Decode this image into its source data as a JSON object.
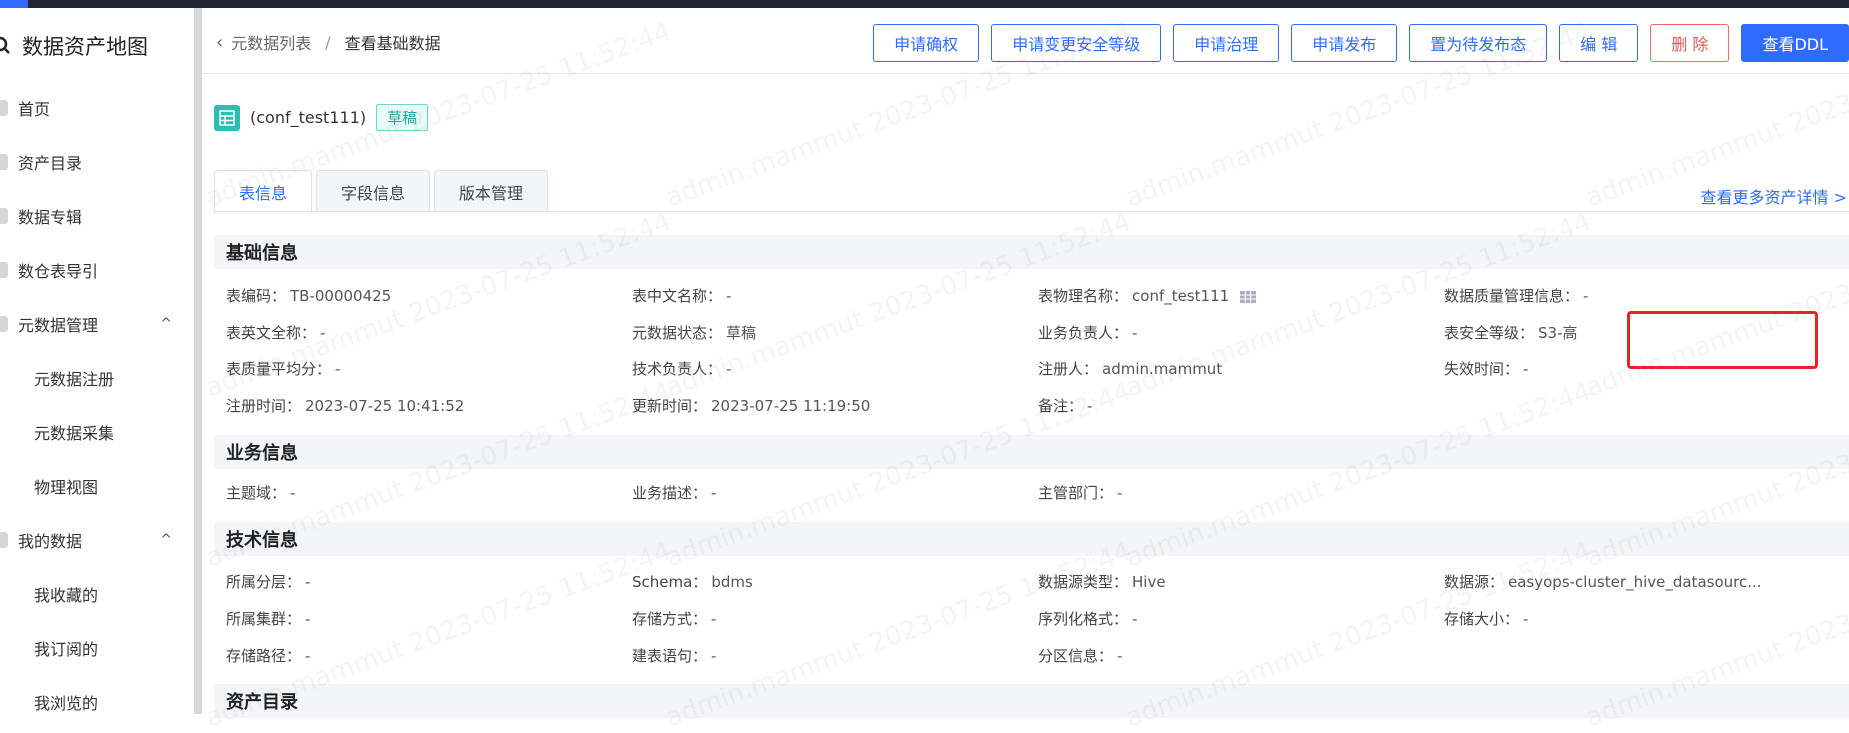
{
  "sidebar": {
    "title": "数据资产地图",
    "items": [
      {
        "label": "首页"
      },
      {
        "label": "资产目录"
      },
      {
        "label": "数据专辑"
      },
      {
        "label": "数仓表导引"
      },
      {
        "label": "元数据管理",
        "chevron": "^"
      },
      {
        "label": "元数据注册"
      },
      {
        "label": "元数据采集"
      },
      {
        "label": "物理视图"
      },
      {
        "label": "我的数据",
        "chevron": "^"
      },
      {
        "label": "我收藏的"
      },
      {
        "label": "我订阅的"
      },
      {
        "label": "我浏览的"
      }
    ]
  },
  "breadcrumb": {
    "parent": "元数据列表",
    "separator": "/",
    "current": "查看基础数据"
  },
  "actions": {
    "confirm_ownership": "申请确权",
    "change_security": "申请变更安全等级",
    "governance": "申请治理",
    "publish": "申请发布",
    "set_pending": "置为待发布态",
    "edit": "编 辑",
    "delete": "删 除",
    "view_ddl": "查看DDL"
  },
  "table": {
    "name": "(conf_test111)",
    "status_badge": "草稿"
  },
  "tabs": [
    {
      "label": "表信息"
    },
    {
      "label": "字段信息"
    },
    {
      "label": "版本管理"
    }
  ],
  "more_link": "查看更多资产详情 >",
  "sections": {
    "basic": {
      "title": "基础信息",
      "fields": {
        "code": {
          "k": "表编码：",
          "v": "TB-00000425"
        },
        "cn_name": {
          "k": "表中文名称：",
          "v": "-"
        },
        "physical_name": {
          "k": "表物理名称：",
          "v": "conf_test111"
        },
        "quality_info": {
          "k": "数据质量管理信息：",
          "v": "-"
        },
        "en_full_name": {
          "k": "表英文全称：",
          "v": "-"
        },
        "meta_status": {
          "k": "元数据状态：",
          "v": "草稿"
        },
        "biz_owner": {
          "k": "业务负责人：",
          "v": "-"
        },
        "security_level": {
          "k": "表安全等级：",
          "v": "S3-高"
        },
        "quality_avg": {
          "k": "表质量平均分：",
          "v": "-"
        },
        "tech_owner": {
          "k": "技术负责人：",
          "v": "-"
        },
        "registrant": {
          "k": "注册人：",
          "v": "admin.mammut"
        },
        "expire_time": {
          "k": "失效时间：",
          "v": "-"
        },
        "register_time": {
          "k": "注册时间：",
          "v": "2023-07-25 10:41:52"
        },
        "update_time": {
          "k": "更新时间：",
          "v": "2023-07-25 11:19:50"
        },
        "remark": {
          "k": "备注：",
          "v": "-"
        }
      }
    },
    "business": {
      "title": "业务信息",
      "fields": {
        "domain": {
          "k": "主题域：",
          "v": "-"
        },
        "desc": {
          "k": "业务描述：",
          "v": "-"
        },
        "dept": {
          "k": "主管部门：",
          "v": "-"
        }
      }
    },
    "technical": {
      "title": "技术信息",
      "fields": {
        "layer": {
          "k": "所属分层：",
          "v": "-"
        },
        "schema": {
          "k": "Schema：",
          "v": "bdms"
        },
        "source_type": {
          "k": "数据源类型：",
          "v": "Hive"
        },
        "source": {
          "k": "数据源：",
          "v": "easyops-cluster_hive_datasourc..."
        },
        "cluster": {
          "k": "所属集群：",
          "v": "-"
        },
        "storage_mode": {
          "k": "存储方式：",
          "v": "-"
        },
        "serialization": {
          "k": "序列化格式：",
          "v": "-"
        },
        "storage_size": {
          "k": "存储大小：",
          "v": "-"
        },
        "storage_path": {
          "k": "存储路径：",
          "v": "-"
        },
        "ddl": {
          "k": "建表语句：",
          "v": "-"
        },
        "partition": {
          "k": "分区信息：",
          "v": "-"
        }
      }
    },
    "catalog": {
      "title": "资产目录"
    }
  },
  "watermark": "admin.mammut 2023-07-25 11:52:44",
  "colors": {
    "primary": "#2f6bff",
    "danger": "#f05555",
    "teal": "#2bbfb3",
    "highlight": "#e8242b"
  }
}
